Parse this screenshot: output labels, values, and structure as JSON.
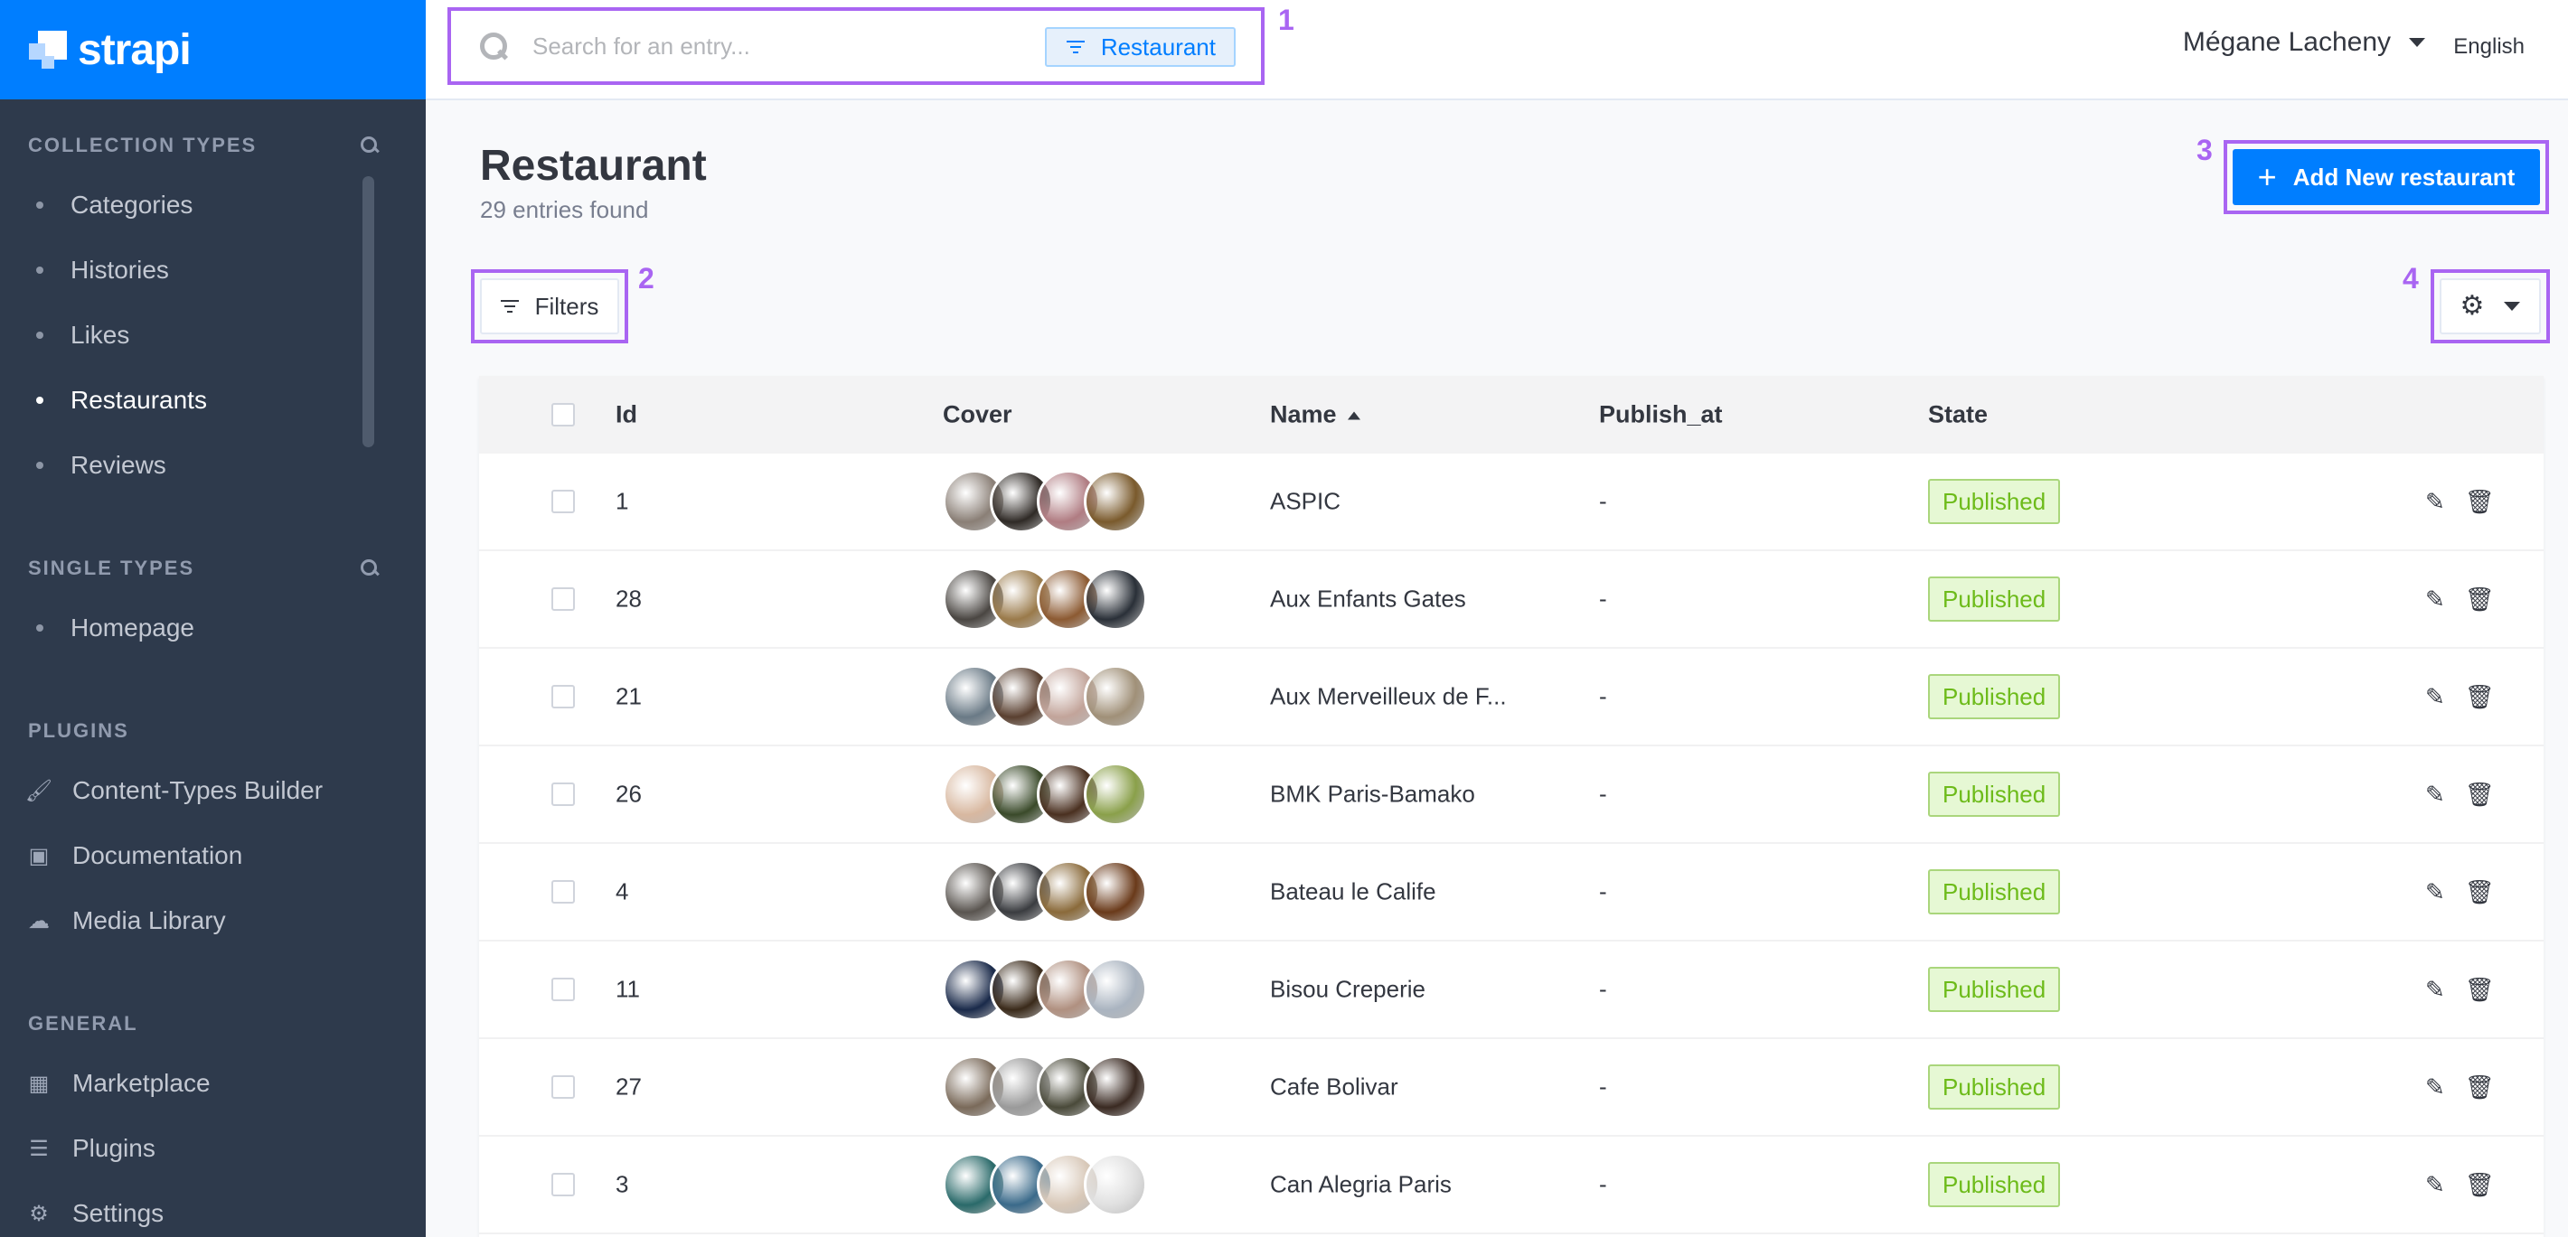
{
  "brand": {
    "name": "strapi"
  },
  "sidebar": {
    "collection_types": {
      "title": "COLLECTION TYPES",
      "items": [
        {
          "label": "Categories",
          "active": false
        },
        {
          "label": "Histories",
          "active": false
        },
        {
          "label": "Likes",
          "active": false
        },
        {
          "label": "Restaurants",
          "active": true
        },
        {
          "label": "Reviews",
          "active": false
        }
      ]
    },
    "single_types": {
      "title": "SINGLE TYPES",
      "items": [
        {
          "label": "Homepage"
        }
      ]
    },
    "plugins": {
      "title": "PLUGINS",
      "items": [
        {
          "label": "Content-Types Builder",
          "icon": "paintbrush-icon"
        },
        {
          "label": "Documentation",
          "icon": "book-icon"
        },
        {
          "label": "Media Library",
          "icon": "cloud-upload-icon"
        }
      ]
    },
    "general": {
      "title": "GENERAL",
      "items": [
        {
          "label": "Marketplace",
          "icon": "basket-icon"
        },
        {
          "label": "Plugins",
          "icon": "list-icon"
        },
        {
          "label": "Settings",
          "icon": "gear-icon"
        }
      ]
    }
  },
  "header": {
    "search": {
      "placeholder": "Search for an entry...",
      "filter_label": "Restaurant"
    },
    "user": "Mégane Lacheny",
    "language": "English"
  },
  "callouts": [
    "1",
    "2",
    "3",
    "4"
  ],
  "page": {
    "title": "Restaurant",
    "subtitle": "29 entries found",
    "add_button": "Add New restaurant",
    "filters_button": "Filters"
  },
  "table": {
    "columns": [
      "Id",
      "Cover",
      "Name",
      "Publish_at",
      "State"
    ],
    "sorted_column": "Name",
    "rows": [
      {
        "id": "1",
        "name": "ASPIC",
        "publish_at": "-",
        "state": "Published",
        "covers": [
          "#8a7f76",
          "#2f2a26",
          "#b07c82",
          "#7a5a2c"
        ]
      },
      {
        "id": "28",
        "name": "Aux Enfants Gates",
        "publish_at": "-",
        "state": "Published",
        "covers": [
          "#4a4642",
          "#9a7a4a",
          "#8c5a32",
          "#2a3038"
        ]
      },
      {
        "id": "21",
        "name": "Aux Merveilleux de F...",
        "publish_at": "-",
        "state": "Published",
        "covers": [
          "#6a7a86",
          "#5a4030",
          "#c2a49a",
          "#a09078"
        ]
      },
      {
        "id": "26",
        "name": "BMK Paris-Bamako",
        "publish_at": "-",
        "state": "Published",
        "covers": [
          "#d8b8a0",
          "#3a4a2a",
          "#4a3020",
          "#8aa04a"
        ]
      },
      {
        "id": "4",
        "name": "Bateau le Calife",
        "publish_at": "-",
        "state": "Published",
        "covers": [
          "#5a5550",
          "#3a3c40",
          "#8a6a3a",
          "#6a3a1a"
        ]
      },
      {
        "id": "11",
        "name": "Bisou Creperie",
        "publish_at": "-",
        "state": "Published",
        "covers": [
          "#1a2a4a",
          "#3a2a1a",
          "#b09080",
          "#aab4c0"
        ]
      },
      {
        "id": "27",
        "name": "Cafe Bolivar",
        "publish_at": "-",
        "state": "Published",
        "covers": [
          "#7a6a5a",
          "#9a9a9a",
          "#4a4a3a",
          "#3a2a22"
        ]
      },
      {
        "id": "3",
        "name": "Can Alegria Paris",
        "publish_at": "-",
        "state": "Published",
        "covers": [
          "#2a6a6a",
          "#3a6a8a",
          "#d8c8b8",
          "#e0e0e0"
        ]
      }
    ]
  },
  "colors": {
    "primary": "#007eff",
    "sidebar_bg": "#2e3a4c",
    "callout": "#a965f2",
    "published_bg": "#e6f8d4",
    "published_text": "#6dbb1a"
  }
}
